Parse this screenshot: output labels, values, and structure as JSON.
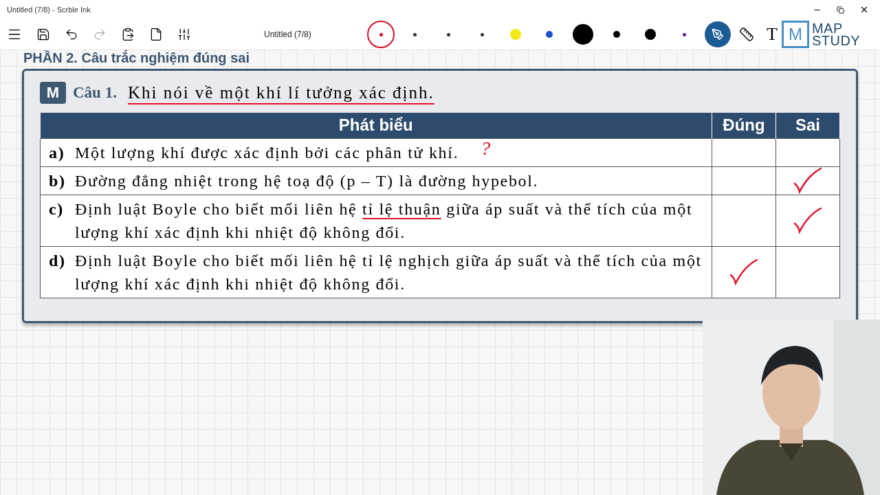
{
  "window": {
    "title": "Untitled (7/8) - Scrble Ink"
  },
  "toolbar": {
    "document_title": "Untitled (7/8)",
    "text_tool": "T"
  },
  "pens": [
    {
      "kind": "ring",
      "color": "#d0102a",
      "selected": true
    },
    {
      "kind": "dot",
      "color": "#333333",
      "selected": false
    },
    {
      "kind": "dot",
      "color": "#333333",
      "selected": false
    },
    {
      "kind": "dot",
      "color": "#333333",
      "selected": false
    },
    {
      "kind": "medium",
      "color": "#f2ea1c",
      "selected": false
    },
    {
      "kind": "small",
      "color": "#1d4fcf",
      "selected": false
    },
    {
      "kind": "large",
      "color": "#000000",
      "selected": false
    },
    {
      "kind": "small",
      "color": "#000000",
      "selected": false
    },
    {
      "kind": "medium",
      "color": "#000000",
      "selected": false
    },
    {
      "kind": "dot",
      "color": "#6a1a9a",
      "selected": false
    }
  ],
  "logo": {
    "mark": "M",
    "line1": "MAP",
    "line2": "STUDY"
  },
  "section_heading": "PHẦN 2. Câu trắc nghiệm đúng sai",
  "question": {
    "badge": "M",
    "number": "Câu 1.",
    "text": "Khi nói về một khí lí tưởng xác định.",
    "inked": true
  },
  "table": {
    "columns": [
      "Phát biểu",
      "Đúng",
      "Sai"
    ],
    "rows": [
      {
        "label": "a)",
        "parts": [
          {
            "text": "Một lượng khí được xác định bởi các phân tử khí.",
            "inked": false
          }
        ],
        "note": "?",
        "dung": false,
        "sai": false
      },
      {
        "label": "b)",
        "parts": [
          {
            "text": "Đường đẳng nhiệt trong hệ toạ độ (p – T) là đường hypebol.",
            "inked": false
          }
        ],
        "dung": false,
        "sai": true
      },
      {
        "label": "c)",
        "parts": [
          {
            "text": "Định luật Boyle cho biết mối liên hệ ",
            "inked": false
          },
          {
            "text": "tỉ lệ thuận",
            "inked": true
          },
          {
            "text": " giữa áp suất và thể tích của một lượng khí xác định khi nhiệt độ không đổi.",
            "inked": false
          }
        ],
        "dung": false,
        "sai": true
      },
      {
        "label": "d)",
        "parts": [
          {
            "text": "Định luật Boyle cho biết mối liên hệ tỉ lệ nghịch giữa áp suất và thể tích của một lượng khí xác định khi nhiệt độ không đổi.",
            "inked": false
          }
        ],
        "dung": true,
        "sai": false
      }
    ]
  }
}
